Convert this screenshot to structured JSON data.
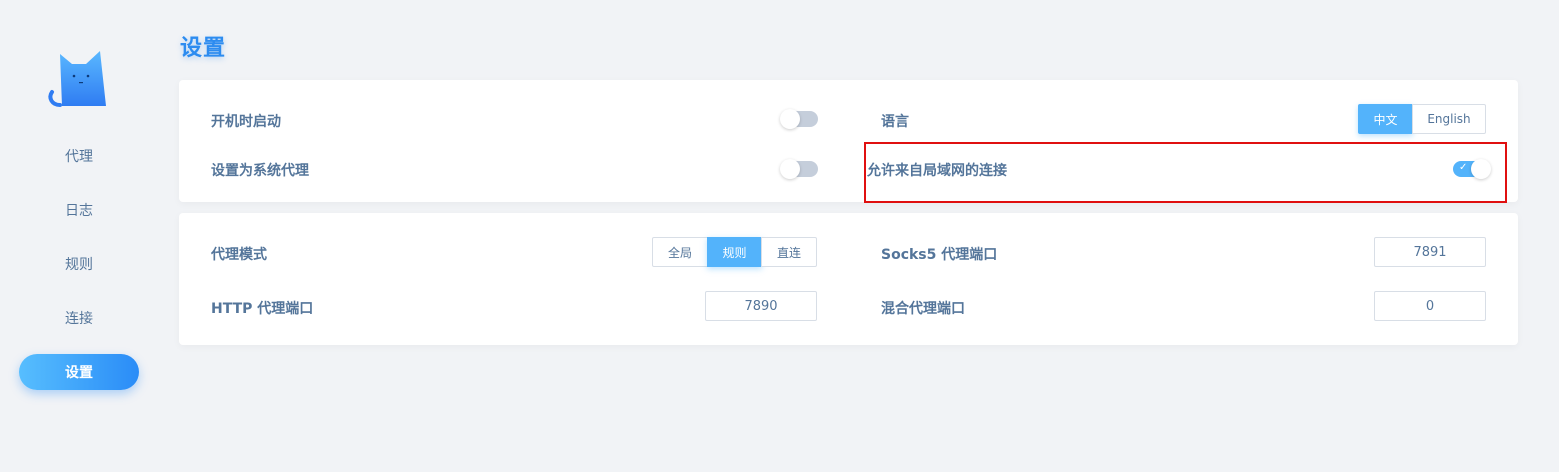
{
  "page": {
    "title": "设置"
  },
  "sidebar": {
    "logo_icon": "cat-logo-icon",
    "items": [
      {
        "label": "代理",
        "active": false
      },
      {
        "label": "日志",
        "active": false
      },
      {
        "label": "规则",
        "active": false
      },
      {
        "label": "连接",
        "active": false
      },
      {
        "label": "设置",
        "active": true
      }
    ]
  },
  "general": {
    "start_on_boot": {
      "label": "开机时启动",
      "enabled": false
    },
    "system_proxy": {
      "label": "设置为系统代理",
      "enabled": false
    },
    "language": {
      "label": "语言",
      "options": [
        "中文",
        "English"
      ],
      "selected": "中文"
    },
    "allow_lan": {
      "label": "允许来自局域网的连接",
      "enabled": true,
      "check_icon": "check-icon"
    }
  },
  "proxy": {
    "mode": {
      "label": "代理模式",
      "options": [
        "全局",
        "规则",
        "直连"
      ],
      "selected": "规则"
    },
    "http_port": {
      "label": "HTTP 代理端口",
      "value": "7890"
    },
    "socks5_port": {
      "label": "Socks5 代理端口",
      "value": "7891"
    },
    "mixed_port": {
      "label": "混合代理端口",
      "value": "0"
    }
  },
  "colors": {
    "accent": "#53b3fb",
    "title": "#2d8cf0",
    "text": "#54759a",
    "highlight": "#e01010"
  }
}
